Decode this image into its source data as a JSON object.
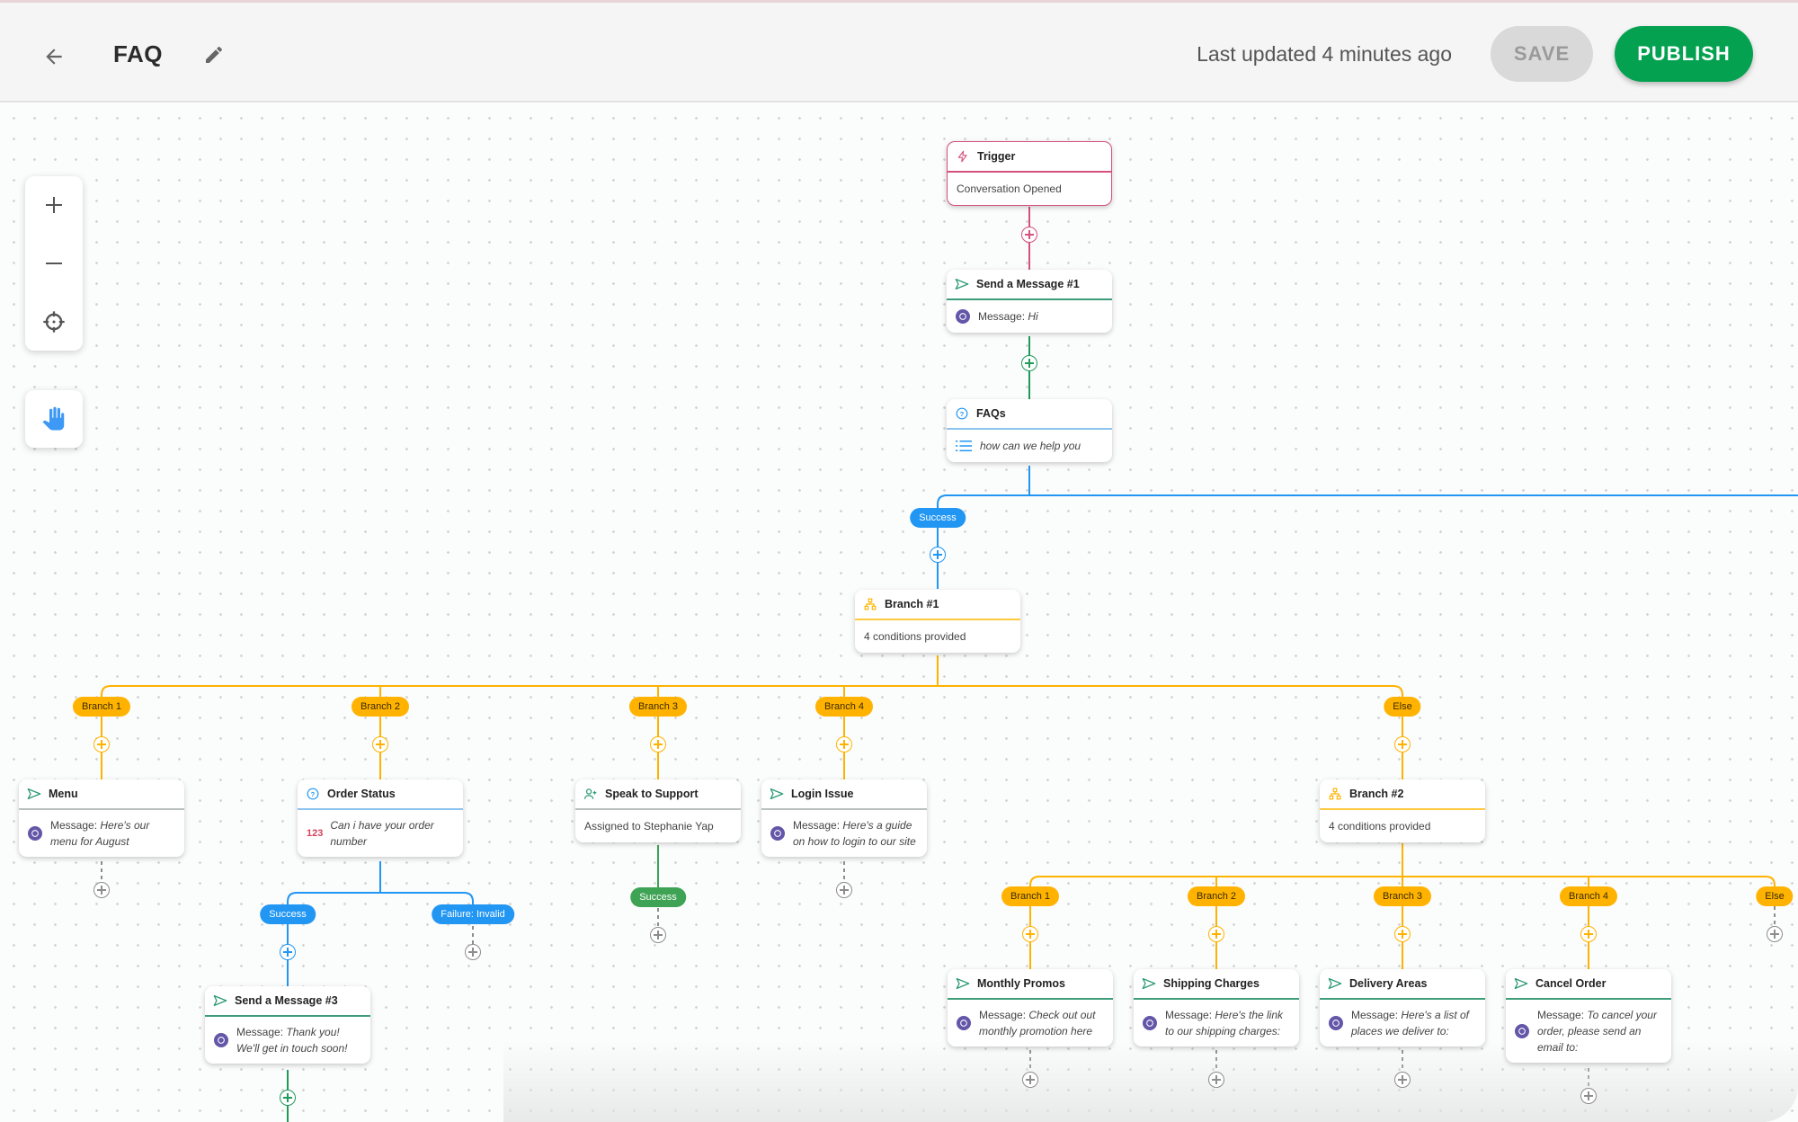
{
  "header": {
    "title": "FAQ",
    "last_updated": "Last updated 4 minutes ago",
    "save_label": "SAVE",
    "publish_label": "PUBLISH",
    "icons": {
      "back": "arrow-left-icon",
      "edit": "pencil-icon"
    }
  },
  "toolbar": {
    "zoom_in": "plus-icon",
    "zoom_out": "minus-icon",
    "recenter": "crosshair-icon",
    "pan": "hand-icon"
  },
  "colors": {
    "publish": "#04a150",
    "trigger": "#d4517f",
    "message": "#1f9a59",
    "faq": "#2196f3",
    "branch": "#ffb300",
    "viber": "#6456a8"
  },
  "nodes": {
    "trigger": {
      "title": "Trigger",
      "body": "Conversation Opened"
    },
    "send1": {
      "title": "Send a Message #1",
      "label": "Message: ",
      "value": "Hi"
    },
    "faqs": {
      "title": "FAQs",
      "value": "how can we help you"
    },
    "branch1": {
      "title": "Branch #1",
      "body": "4 conditions provided"
    },
    "menu": {
      "title": "Menu",
      "label": "Message: ",
      "value": "Here's our menu for August"
    },
    "order_status": {
      "title": "Order Status",
      "num_icon": "123",
      "value": "Can i have your order number"
    },
    "speak_support": {
      "title": "Speak to Support",
      "body": "Assigned to Stephanie Yap"
    },
    "login_issue": {
      "title": "Login Issue",
      "label": "Message: ",
      "value": "Here's a guide on how to login to our site"
    },
    "branch2": {
      "title": "Branch #2",
      "body": "4 conditions provided"
    },
    "send3": {
      "title": "Send a Message #3",
      "label": "Message: ",
      "value": "Thank you! We'll get in touch soon!"
    },
    "monthly_promos": {
      "title": "Monthly Promos",
      "label": "Message: ",
      "value": "Check out out monthly promotion here"
    },
    "shipping": {
      "title": "Shipping Charges",
      "label": "Message: ",
      "value": "Here's the link to our shipping charges:"
    },
    "delivery": {
      "title": "Delivery Areas",
      "label": "Message: ",
      "value": "Here's a list of places we deliver to:"
    },
    "cancel": {
      "title": "Cancel Order",
      "label": "Message: ",
      "value": "To cancel your order, please send an email to:"
    }
  },
  "pills": {
    "faq_success": "Success",
    "b1_1": "Branch 1",
    "b1_2": "Branch 2",
    "b1_3": "Branch 3",
    "b1_4": "Branch 4",
    "b1_else": "Else",
    "order_success": "Success",
    "order_failure": "Failure: Invalid",
    "support_success": "Success",
    "b2_1": "Branch 1",
    "b2_2": "Branch 2",
    "b2_3": "Branch 3",
    "b2_4": "Branch 4",
    "b2_else": "Else"
  }
}
